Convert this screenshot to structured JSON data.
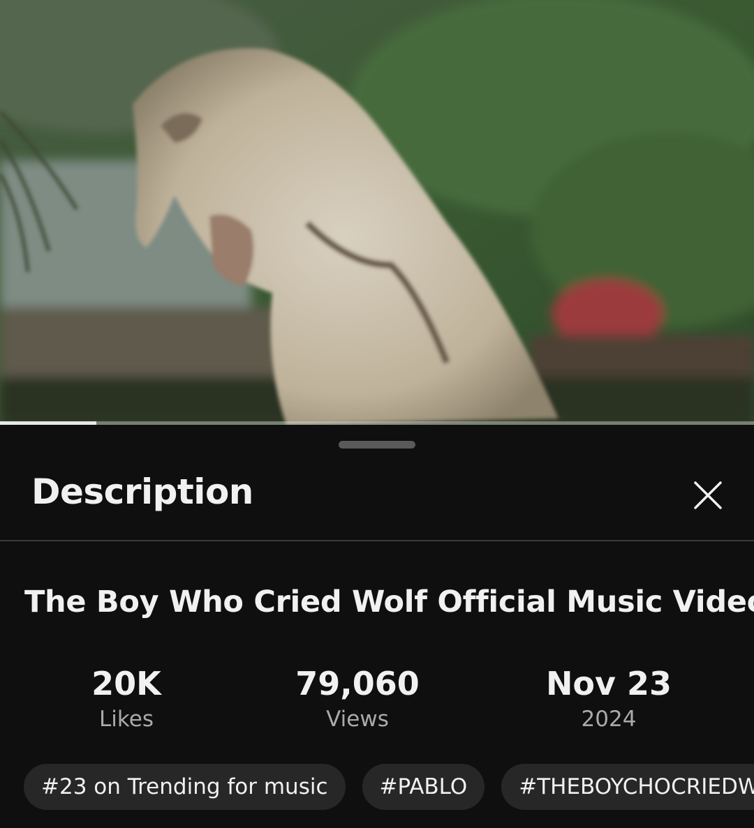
{
  "video": {
    "progress_fraction": 0.128
  },
  "description_panel": {
    "title": "Description",
    "close_icon": "close-icon"
  },
  "video_info": {
    "title": "The Boy Who Cried Wolf Official Music Video",
    "stats": [
      {
        "value": "20K",
        "label": "Likes"
      },
      {
        "value": "79,060",
        "label": "Views"
      },
      {
        "value": "Nov 23",
        "label": "2024"
      }
    ],
    "chips": [
      "#23 on Trending for music",
      "#PABLO",
      "#THEBOYCHOCRIEDWOLF"
    ]
  },
  "colors": {
    "background": "#0f0f0f",
    "chip_background": "#272727",
    "secondary_text": "#aaaaaa"
  }
}
